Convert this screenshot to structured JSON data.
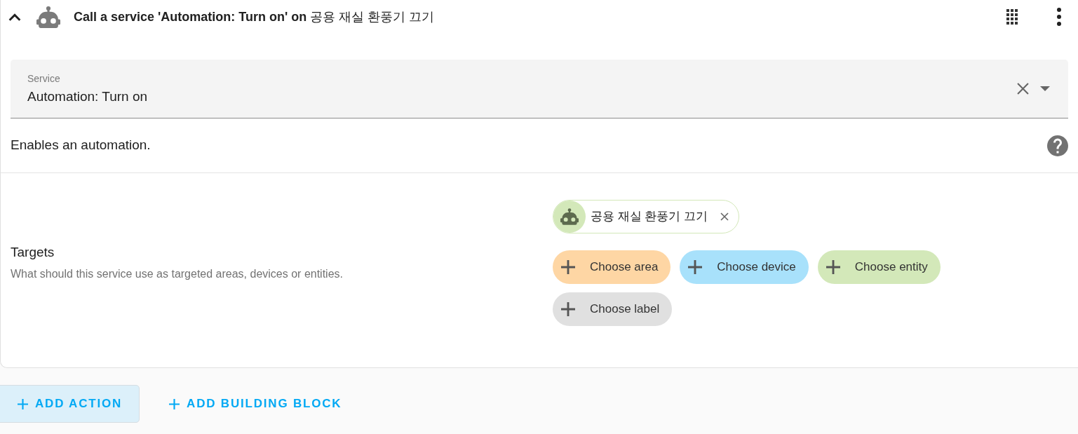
{
  "header": {
    "title": "**Call a service 'Automation: Turn on' on** 공용 재실 환풍기 끄기",
    "expanded": true
  },
  "service_field": {
    "label": "Service",
    "value": "Automation: Turn on"
  },
  "description": "Enables an automation.",
  "targets": {
    "title": "Targets",
    "description": "What should this service use as targeted areas, devices or entities.",
    "selected": [
      {
        "name": "공용 재실 환풍기 끄기"
      }
    ],
    "add_buttons": [
      {
        "label": "Choose area",
        "color": "#fed6a4"
      },
      {
        "label": "Choose device",
        "color": "#a8e1fb"
      },
      {
        "label": "Choose entity",
        "color": "#d3e8b9"
      },
      {
        "label": "Choose label",
        "color": "#e0e0e0"
      }
    ]
  },
  "footer_buttons": [
    {
      "label": "ADD ACTION",
      "kind": "outlined"
    },
    {
      "label": "ADD BUILDING BLOCK",
      "kind": "text"
    }
  ]
}
